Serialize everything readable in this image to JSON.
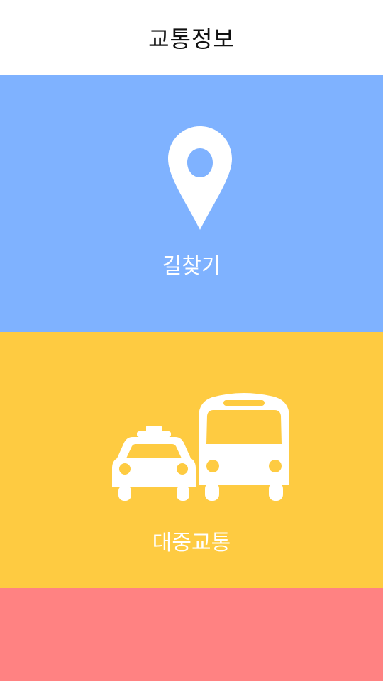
{
  "header": {
    "title": "교통정보"
  },
  "tiles": [
    {
      "label": "길찾기",
      "icon": "map-pin-icon",
      "color": "#7fb2ff"
    },
    {
      "label": "대중교통",
      "icon": "taxi-bus-icon",
      "color": "#fecb41"
    },
    {
      "label": "",
      "icon": "",
      "color": "#ff8282"
    }
  ],
  "colors": {
    "header_bg": "#ffffff",
    "title_text": "#111111",
    "tile_text": "#ffffff"
  }
}
